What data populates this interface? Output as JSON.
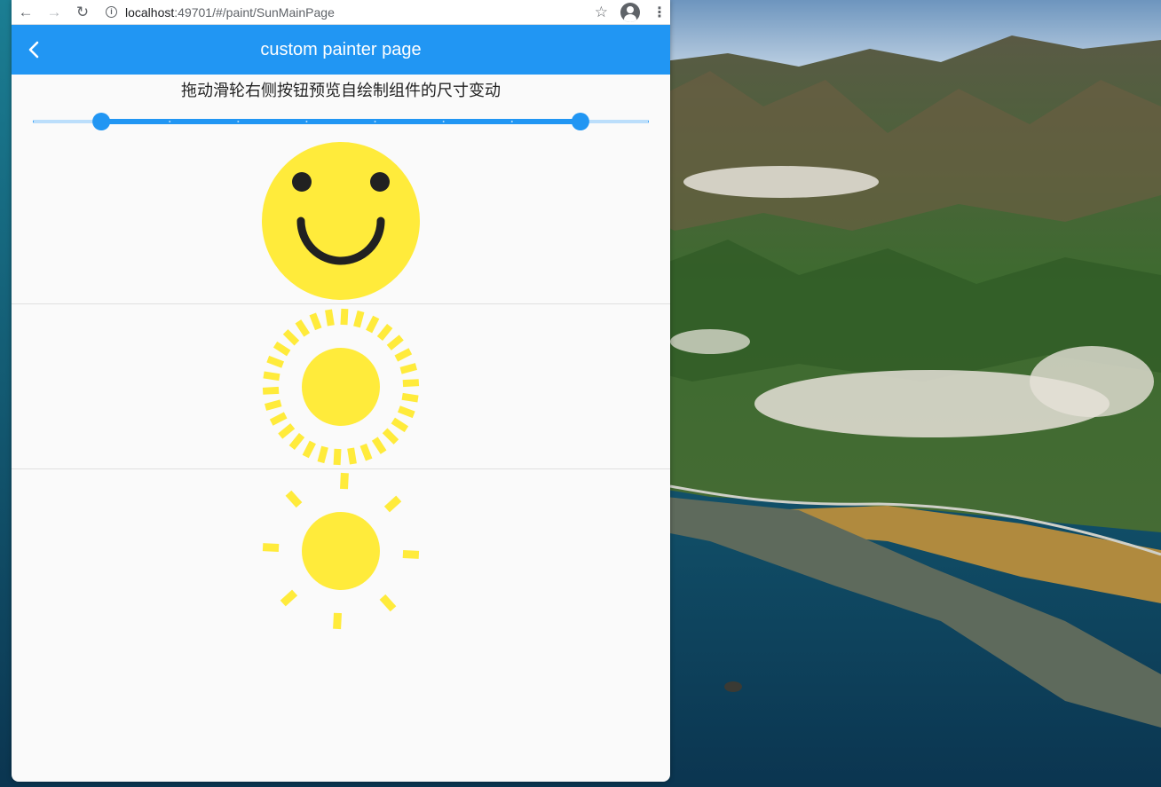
{
  "browser": {
    "url_host": "localhost",
    "url_path": ":49701/#/paint/SunMainPage",
    "back_icon": "arrow-left-icon",
    "forward_icon": "arrow-right-icon",
    "reload_icon": "reload-icon",
    "info_icon": "info-icon",
    "star_icon": "star-icon",
    "profile_icon": "profile-icon",
    "menu_icon": "kebab-menu-icon"
  },
  "app_bar": {
    "title": "custom painter page",
    "back_icon": "chevron-left-icon",
    "color": "#2196f3"
  },
  "hint_text": "拖动滑轮右侧按钮预览自绘制组件的尺寸变动",
  "range_slider": {
    "min": 0,
    "max": 9,
    "divisions": 9,
    "start_value": 1,
    "end_value": 8,
    "active_color": "#2196f3",
    "inactive_color": "#bbdefb"
  },
  "sun_color": "#ffeb3b",
  "face_color": "#212121",
  "panels": [
    "smiley-face",
    "sun-dense-rays",
    "sun-sparse-rays"
  ]
}
